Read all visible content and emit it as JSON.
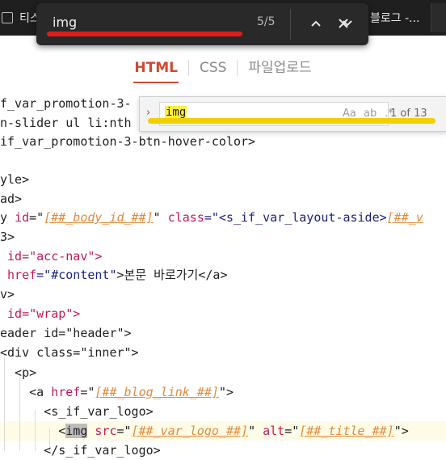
{
  "browser": {
    "tab_left_title": "티스",
    "tab_right_title": "블로그 -..."
  },
  "findbar": {
    "query": "img",
    "count": "5/5",
    "prev_label": "⌃",
    "next_label": "⌄",
    "close_label": "✕"
  },
  "editor_tabs": [
    {
      "label": "HTML",
      "active": true
    },
    {
      "label": "CSS",
      "active": false
    },
    {
      "label": "파일업로드",
      "active": false
    }
  ],
  "editor_find": {
    "query": "img",
    "opt_case": "Aa",
    "opt_word": "ab",
    "opt_regex": ".*",
    "count": "1 of 13"
  },
  "code_lines": [
    "f_var_promotion-3-",
    "n-slider ul li:nth",
    "if_var_promotion-3-btn-hover-color>",
    "",
    "yle>",
    "ad>",
    "",
    "3>",
    "",
    "",
    "v>",
    "",
    "eader id=\"header\">",
    "<div class=\"inner\">",
    "  <p>",
    "",
    "",
    "",
    "      </s_if_var_logo>"
  ],
  "code_fragments": {
    "body_prefix": "y ",
    "id_attr": "id",
    "eq_quote": "=\"",
    "body_tpl": "[##_body_id_##]",
    "close_quote": "\"",
    "class_attr": "class",
    "class_val_start": "=\"<s_if_var_layout-aside>",
    "class_tpl": "[##_v",
    "acc_nav": " id=\"acc-nav\">",
    "href_attr": " href",
    "href_val": "=\"#content\"",
    "skip_text": ">본문 바로가기</a>",
    "wrap_line": " id=\"wrap\">",
    "a_open": "    <a ",
    "href2": "href",
    "blog_tpl": "[##_blog_link_##]",
    "a_close": "\">",
    "logo_open": "      <s_if_var_logo>",
    "img_lt": "        <",
    "img_tag": "img",
    "src_attr": " src",
    "logo_tpl": "[##_var_logo_##]",
    "alt_attr": " alt",
    "title_tpl": "[##_title_##]",
    "img_end": "\">"
  }
}
